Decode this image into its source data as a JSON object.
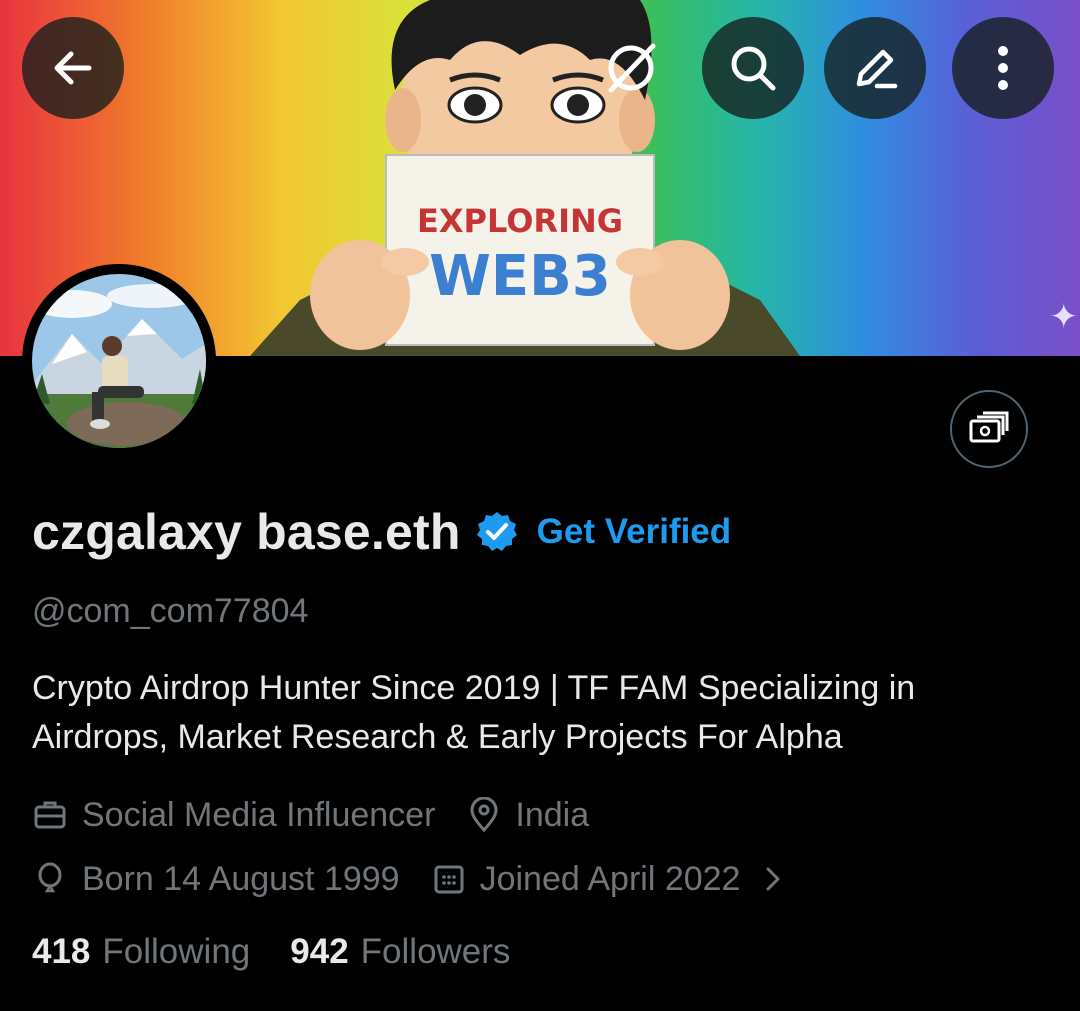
{
  "banner": {
    "sign_line1": "EXPLORING",
    "sign_line2": "WEB3"
  },
  "top_actions": [
    {
      "icon": "back-arrow-icon"
    },
    {
      "icon": "grok-icon"
    },
    {
      "icon": "search-icon"
    },
    {
      "icon": "edit-icon"
    },
    {
      "icon": "more-vertical-icon"
    }
  ],
  "profile": {
    "display_name": "czgalaxy base.eth",
    "verified_badge_color": "#1d9bf0",
    "get_verified_label": "Get Verified",
    "handle": "@com_com77804",
    "bio": "Crypto Airdrop Hunter Since 2019 | TF FAM Specializing in Airdrops, Market Research & Early Projects For Alpha",
    "profession": "Social Media Influencer",
    "location": "India",
    "birthday": "Born 14 August 1999",
    "joined": "Joined April 2022"
  },
  "stats": {
    "following_count": "418",
    "following_label": "Following",
    "followers_count": "942",
    "followers_label": "Followers"
  },
  "colors": {
    "background": "#000000",
    "primary_text": "#e7e9ea",
    "secondary_text": "#71767b",
    "accent": "#1d9bf0"
  }
}
